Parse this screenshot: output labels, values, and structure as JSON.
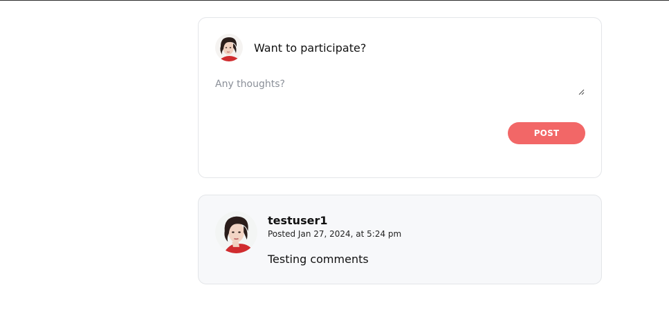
{
  "compose": {
    "title": "Want to participate?",
    "input_placeholder": "Any thoughts?",
    "input_value": "",
    "post_label": "POST",
    "post_color": "#f26767"
  },
  "comments": [
    {
      "author": "testuser1",
      "meta": "Posted Jan 27, 2024, at 5:24 pm",
      "text": "Testing comments"
    }
  ],
  "icons": {
    "compose_avatar": "user-avatar-icon",
    "comment_avatar": "user-avatar-icon",
    "resize_handle": "resize-grip-icon"
  },
  "colors": {
    "comment_background": "#f7f8fa",
    "card_border": "#e3e5e8"
  }
}
